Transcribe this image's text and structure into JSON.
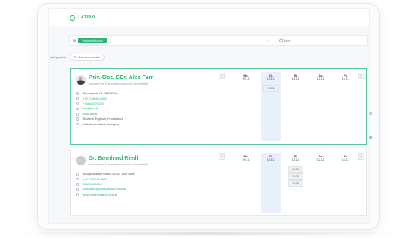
{
  "app": {
    "logo": "LATIDO"
  },
  "search": {
    "selected_chip": "Frauenheilkunde",
    "controls": "× ⌄",
    "location": "Wien"
  },
  "filters": {
    "label": "Verfügbarkeit",
    "chip": "Videokonsultation"
  },
  "doctors": [
    {
      "name": "Priv.-Doz. DDr. Alex Farr",
      "specialty": "Facharzt für Frauenheilkunde und Geburtshilfe",
      "info": [
        {
          "icon": "location-icon",
          "text": "Börsehplatz 7A, 1100 Wien",
          "link": false
        },
        {
          "icon": "phone-icon",
          "text": "+43 1 28450-5500",
          "link": true
        },
        {
          "icon": "phone-icon",
          "text": "+436603070274",
          "link": true
        },
        {
          "icon": "mail-icon",
          "text": "info@farr.at",
          "link": true
        },
        {
          "icon": "globe-icon",
          "text": "www.farr.at",
          "link": true
        },
        {
          "icon": "language-icon",
          "text": "Deutsch, Englisch, Französisch",
          "link": false
        },
        {
          "icon": "video-icon",
          "text": "Videokonsultation verfügbar",
          "link": false
        }
      ],
      "days": [
        {
          "name": "Mo.",
          "date": "09.11.",
          "selected": false,
          "slots": [
            "-",
            "-",
            "-",
            "-",
            "-",
            "-"
          ]
        },
        {
          "name": "Di.",
          "date": "10.11.",
          "selected": true,
          "slots": [
            "10:00",
            "-",
            "-",
            "-",
            "-",
            "-"
          ]
        },
        {
          "name": "Mi.",
          "date": "11.11.",
          "selected": false,
          "slots": [
            "-",
            "-",
            "-",
            "-",
            "-",
            "-"
          ]
        },
        {
          "name": "Do.",
          "date": "12.11.",
          "selected": false,
          "slots": [
            "-",
            "-",
            "-",
            "-",
            "-",
            "-"
          ]
        },
        {
          "name": "Fr.",
          "date": "13.11.",
          "selected": false,
          "slots": [
            "-",
            "-",
            "-",
            "-",
            "-",
            "-"
          ]
        }
      ]
    },
    {
      "name": "Dr. Bernhard Riedl",
      "specialty": "Facharzt für Frauenheilkunde und Geburtshilfe",
      "info": [
        {
          "icon": "location-icon",
          "text": "Heiligenstädter Straße 55-63, 1190 Wien",
          "link": false
        },
        {
          "icon": "phone-icon",
          "text": "+43 1 360 66-8900",
          "link": true
        },
        {
          "icon": "phone-icon",
          "text": "0664 1830508",
          "link": true
        },
        {
          "icon": "mail-icon",
          "text": "ordination@kinderwunsch-riedl.at",
          "link": true
        },
        {
          "icon": "globe-icon",
          "text": "www.kinderwunsch-riedl.at",
          "link": true
        }
      ],
      "days": [
        {
          "name": "Mo.",
          "date": "09.11.",
          "selected": false,
          "slots": [
            "-",
            "-",
            "-",
            "-",
            "-"
          ]
        },
        {
          "name": "Di.",
          "date": "10.11.",
          "selected": true,
          "slots": [
            "-",
            "-",
            "-",
            "-",
            "-"
          ]
        },
        {
          "name": "Mi.",
          "date": "11.11.",
          "selected": false,
          "slots": [
            "10:00",
            "10:30",
            "11:00",
            "-",
            "-"
          ]
        },
        {
          "name": "Do.",
          "date": "12.11.",
          "selected": false,
          "slots": [
            "-",
            "-",
            "-",
            "-",
            "-"
          ]
        },
        {
          "name": "Fr.",
          "date": "13.11.",
          "selected": false,
          "slots": [
            "-",
            "-",
            "-",
            "-",
            "-"
          ]
        }
      ]
    }
  ],
  "nav": {
    "prev": "‹",
    "next": "›"
  }
}
